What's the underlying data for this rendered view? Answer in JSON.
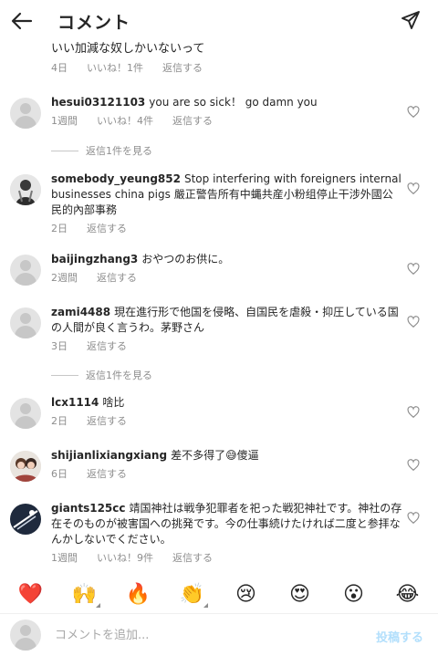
{
  "header": {
    "title": "コメント"
  },
  "top_reply": {
    "text": "いい加減な奴しかいないって",
    "time": "4日",
    "likes": "いいね！1件",
    "reply": "返信する"
  },
  "comments": [
    {
      "username": "hesui03121103",
      "text": "you are so sick！ go damn you",
      "time": "1週間",
      "likes": "いいね！4件",
      "reply": "返信する",
      "view_replies": "返信1件を見る"
    },
    {
      "username": "somebody_yeung852",
      "text": "Stop interfering with foreigners internal businesses china pigs 嚴正警告所有中蝿共産小粉组停止干涉外國公民的內部事務",
      "time": "2日",
      "reply": "返信する"
    },
    {
      "username": "baijingzhang3",
      "text": "おやつのお供に。",
      "time": "2週間",
      "reply": "返信する"
    },
    {
      "username": "zami4488",
      "text": "現在進行形で他国を侵略、自国民を虐殺・抑圧している国の人間が良く言うわ。茅野さん",
      "time": "3日",
      "reply": "返信する",
      "view_replies": "返信1件を見る"
    },
    {
      "username": "lcx1114",
      "text": "啥比",
      "time": "2日",
      "reply": "返信する"
    },
    {
      "username": "shijianlixiangxiang",
      "text": "差不多得了😅傻逼",
      "time": "6日",
      "reply": "返信する"
    },
    {
      "username": "giants125cc",
      "text": "靖国神社は戦争犯罪者を祀った戦犯神社です。神社の存在そのものが被害国への挑発です。今の仕事続けたければ二度と参拝なんかしないでください。",
      "time": "1週間",
      "likes": "いいね！9件",
      "reply": "返信する"
    }
  ],
  "emoji_bar": [
    "❤️",
    "🙌",
    "🔥",
    "👏",
    "😢",
    "😍",
    "😮",
    "😂"
  ],
  "input": {
    "placeholder": "コメントを追加...",
    "post_label": "投稿する"
  },
  "colors": {
    "text": "#262626",
    "secondary": "#8e8e8e",
    "post_disabled": "#b2dffc"
  }
}
